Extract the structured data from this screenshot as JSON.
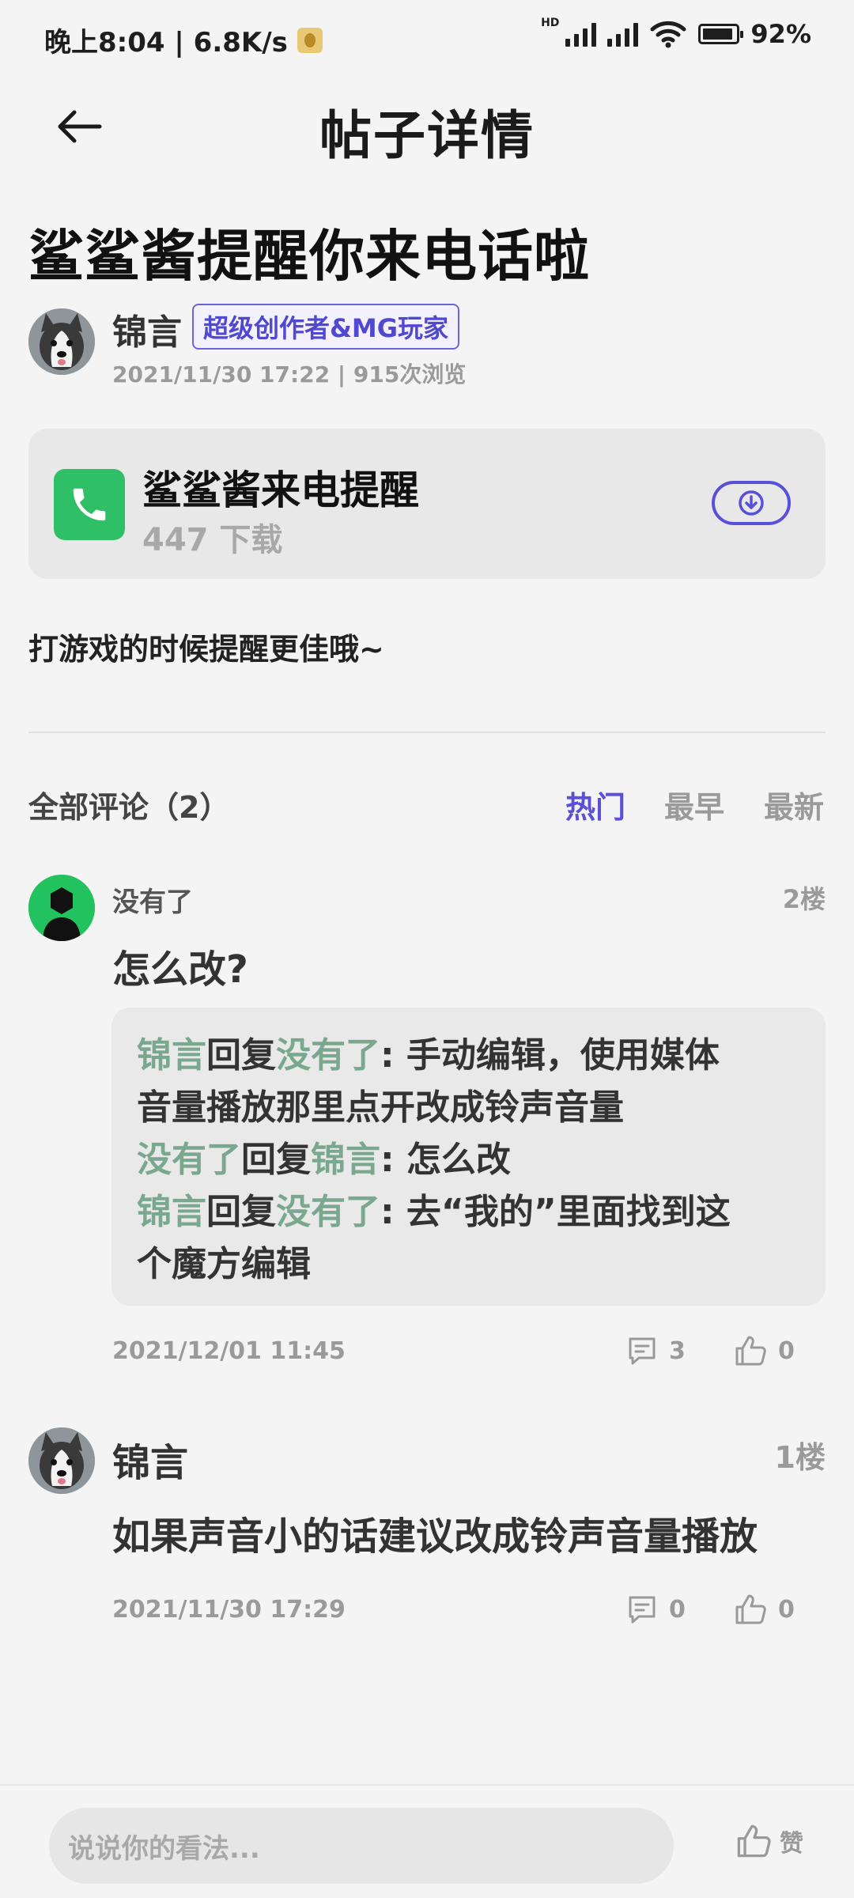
{
  "status_bar": {
    "time": "晚上8:04 | 6.8K/s",
    "hd_label": "HD",
    "battery": "92%",
    "battery_level": 0.92
  },
  "header": {
    "title": "帖子详情"
  },
  "post": {
    "title": "鲨鲨酱提醒你来电话啦",
    "author": "锦言",
    "badge": "超级创作者&MG玩家",
    "meta": "2021/11/30 17:22 | 915次浏览",
    "app": {
      "name": "鲨鲨酱来电提醒",
      "downloads": "447 下载",
      "icon_color": "#2fbf66"
    },
    "body": "打游戏的时候提醒更佳哦~"
  },
  "comments_section": {
    "header": "全部评论（2）",
    "sort_tabs": [
      "热门",
      "最早",
      "最新"
    ],
    "active_tab": "热门",
    "accent_color": "#5a50d8"
  },
  "comments": [
    {
      "user": "没有了",
      "floor": "2楼",
      "text": "怎么改?",
      "time": "2021/12/01 11:45",
      "reply_count": "3",
      "like_count": "0",
      "replies": [
        {
          "from": "锦言",
          "verb": "回复",
          "to": "没有了",
          "text": ": 手动编辑，使用媒体",
          "cont": "音量播放那里点开改成铃声音量"
        },
        {
          "from": "没有了",
          "verb": "回复",
          "to": "锦言",
          "text": ": 怎么改"
        },
        {
          "from": "锦言",
          "verb": "回复",
          "to": "没有了",
          "text": ": 去“我的”里面找到这",
          "cont": "个魔方编辑"
        }
      ]
    },
    {
      "user": "锦言",
      "floor": "1楼",
      "text": "如果声音小的话建议改成铃声音量播放",
      "time": "2021/11/30 17:29",
      "reply_count": "0",
      "like_count": "0"
    }
  ],
  "bottom_bar": {
    "input_placeholder": "说说你的看法...",
    "like_label": "赞"
  }
}
